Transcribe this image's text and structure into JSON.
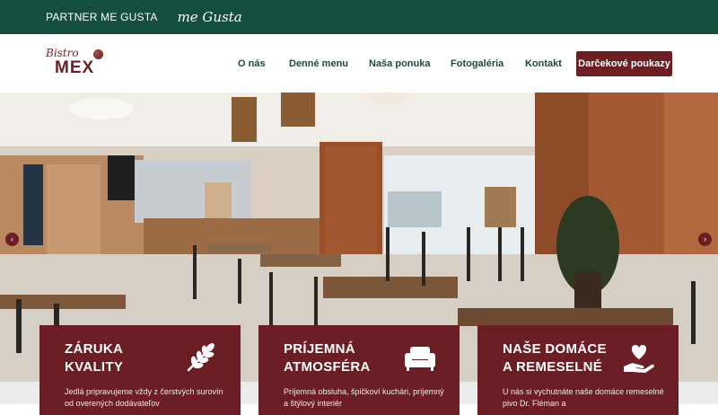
{
  "topbar": {
    "partner_label": "PARTNER ME GUSTA",
    "me_gusta_logo": "me Gusta"
  },
  "brand": {
    "line1": "Bistro",
    "line2": "MEX"
  },
  "nav": {
    "items": [
      "O nás",
      "Denné menu",
      "Naša ponuka",
      "Fotogaléria",
      "Kontakt"
    ],
    "cta": "Darčekové poukazy"
  },
  "colors": {
    "topbar": "#154e3f",
    "accent": "#6b1f24",
    "nav_text": "#1d4a3e"
  },
  "hero": {
    "image": "restaurant-interior-photo",
    "prev_icon": "chevron-left-icon",
    "next_icon": "chevron-right-icon"
  },
  "cards": [
    {
      "title_line1": "ZÁRUKA",
      "title_line2": "KVALITY",
      "icon": "wheat-icon",
      "text": "Jedlá pripravujeme vždy z čerstvých surovín od overených dodávateľov"
    },
    {
      "title_line1": "PRÍJEMNÁ",
      "title_line2": "ATMOSFÉRA",
      "icon": "sofa-icon",
      "text": "Príjemná obsluha, špičkoví kuchári, príjemný a štýlový interiér"
    },
    {
      "title_line1": "NAŠE DOMÁCE",
      "title_line2": "A REMESELNÉ",
      "icon": "heart-hand-icon",
      "text": "U nás si vychutnáte naše domáce remeselné pivo Dr. Fléman a"
    }
  ]
}
